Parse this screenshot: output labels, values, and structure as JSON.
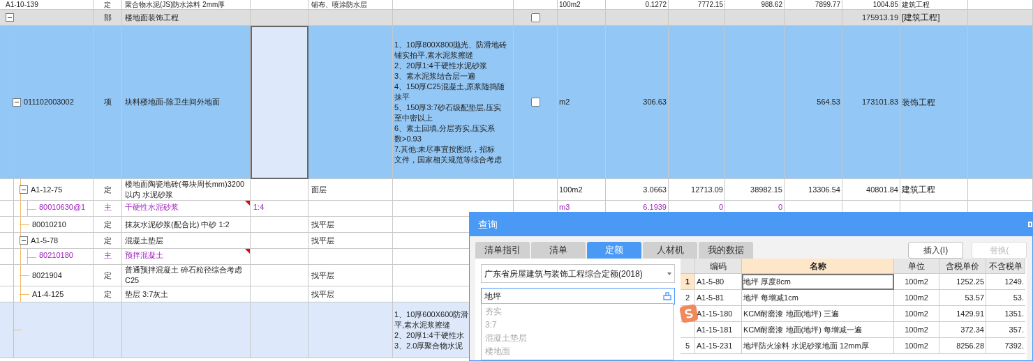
{
  "rows": [
    {
      "kind": "quota",
      "code": "A1-10-139",
      "type": "定",
      "name": "聚合物水泥(JS)防水涂料 2mm厚",
      "column_5": "铺布、喷涂防水层",
      "unit": "100m2",
      "quantity": "0.1272",
      "column_9": "7772.15",
      "column_10": "988.62",
      "column_11": "7899.77",
      "column_12": "1004.85",
      "column_13": "建筑工程"
    },
    {
      "kind": "section",
      "expanded": true,
      "checked": false,
      "type": "部",
      "name": "楼地面装饰工程",
      "column_12": "175913.19",
      "column_13": "[建筑工程]",
      "children": [
        {
          "kind": "item",
          "selected": true,
          "expanded": true,
          "checked": false,
          "code": "011102003002",
          "type": "项",
          "name": "块料楼地面-除卫生间外地面",
          "description": [
            "1、10厚800X800抛光、防滑地砖",
            "铺实拍平,素水泥浆擦缝",
            "2、20厚1:4干硬性水泥砂浆",
            "3、素水泥浆结合层一遍",
            "4、150厚C25混凝土,原浆随捣随",
            "抹平",
            "5、150厚3:7砂石级配垫层,压实",
            "至中密以上",
            "6、素土回填,分层夯实,压实系",
            "数>0.93",
            "7.其他:未尽事宜按图纸，招标",
            "文件，国家相关规范等综合考虑"
          ],
          "unit": "m2",
          "quantity": "306.63",
          "column_11": "564.53",
          "column_12": "173101.83",
          "column_13": "装饰工程",
          "children": [
            {
              "kind": "quota",
              "expanded": true,
              "code": "A1-12-75",
              "type": "定",
              "name": "楼地面陶瓷地砖(每块周长mm)3200以内 水泥砂浆",
              "column_5": "面层",
              "unit": "100m2",
              "quantity": "3.0663",
              "column_9": "12713.09",
              "column_10": "38982.15",
              "column_11": "13306.54",
              "column_12": "40801.84",
              "column_13": "建筑工程",
              "children": [
                {
                  "kind": "material",
                  "flagged": true,
                  "code": "80010630@1",
                  "type": "主",
                  "name": "干硬性水泥砂浆",
                  "column_4": "1:4",
                  "unit": "m3",
                  "quantity": "6.1939",
                  "column_9": "0",
                  "column_10": "0"
                }
              ]
            },
            {
              "kind": "quota",
              "code": "80010210",
              "type": "定",
              "name": "抹灰水泥砂浆(配合比) 中砂 1:2",
              "column_5": "找平层"
            },
            {
              "kind": "quota",
              "expanded": true,
              "code": "A1-5-78",
              "type": "定",
              "name": "混凝土垫层",
              "column_5": "找平层",
              "children": [
                {
                  "kind": "material",
                  "flagged": true,
                  "code": "80210180",
                  "type": "主",
                  "name": "预拌混凝土"
                }
              ]
            },
            {
              "kind": "quota",
              "code": "8021904",
              "type": "定",
              "name": "普通预拌混凝土 碎石粒径综合考虑 C25",
              "column_5": "找平层"
            },
            {
              "kind": "quota",
              "code": "A1-4-125",
              "type": "定",
              "name": "垫层 3:7灰土",
              "column_5": "找平层"
            }
          ]
        },
        {
          "kind": "item",
          "selected": false,
          "description": [
            "1、10厚600X600防滑",
            "平,素水泥浆擦缝",
            "2、20厚1:4干硬性水",
            "3、2.0厚聚合物水泥"
          ]
        }
      ]
    }
  ],
  "dialog": {
    "title": "查询",
    "tabs": [
      {
        "label": "清单指引",
        "selected": false
      },
      {
        "label": "清单",
        "selected": false
      },
      {
        "label": "定额",
        "selected": true
      },
      {
        "label": "人材机",
        "selected": false
      },
      {
        "label": "我的数据",
        "selected": false
      }
    ],
    "buttons": [
      {
        "label": "插入(I)",
        "disabled": false
      },
      {
        "label": "替换(",
        "disabled": true
      }
    ],
    "library": "广东省房屋建筑与装饰工程综合定额(2018)",
    "search": {
      "value": "地坪"
    },
    "suggestions": [
      "夯实",
      "3:7",
      "混凝土垫层",
      "楼地面"
    ],
    "columns": [
      "编码",
      "名称",
      "单位",
      "含税单价",
      "不含税单"
    ],
    "results": [
      {
        "number": "1",
        "selected": true,
        "code": "A1-5-80",
        "name": "地坪 厚度8cm",
        "unit": "100m2",
        "price": "1252.25",
        "price_ex": "1249."
      },
      {
        "number": "2",
        "selected": false,
        "code": "A1-5-81",
        "name": "地坪 每增减1cm",
        "unit": "100m2",
        "price": "53.57",
        "price_ex": "53."
      },
      {
        "selected": false,
        "code": "A1-15-180",
        "name": "KCM耐磨漆 地面(地坪) 三遍",
        "unit": "100m2",
        "price": "1429.91",
        "price_ex": "1351."
      },
      {
        "selected": false,
        "code": "A1-15-181",
        "name": "KCM耐磨漆 地面(地坪) 每增减一遍",
        "unit": "100m2",
        "price": "372.34",
        "price_ex": "357."
      },
      {
        "number": "5",
        "selected": false,
        "code": "A1-15-231",
        "name": "地坪防火涂料 水泥砂浆地面 12mm厚",
        "unit": "100m2",
        "price": "8256.28",
        "price_ex": "7392."
      }
    ]
  }
}
